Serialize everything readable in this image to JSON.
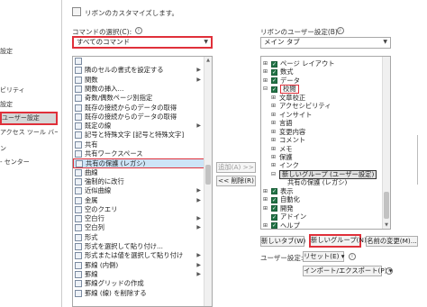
{
  "sidebar": {
    "items": [
      {
        "label": "設定"
      },
      {
        "label": "ビリティ"
      },
      {
        "label": "設定"
      },
      {
        "label": "ユーザー設定",
        "active": true
      },
      {
        "label": "アクセス ツール バー"
      },
      {
        "label": "ン"
      },
      {
        "label": "- センター"
      }
    ]
  },
  "header": {
    "title": "リボンのカスタマイズします。"
  },
  "left": {
    "label": "コマンドの選択(C):",
    "dropdown_value": "すべてのコマンド",
    "commands": [
      {
        "label": "",
        "arrow": false
      },
      {
        "label": "隣のセルの書式を設定する",
        "arrow": true
      },
      {
        "label": "関数",
        "arrow": true
      },
      {
        "label": "関数の挿入...",
        "arrow": false
      },
      {
        "label": "奇数/偶数ページ別指定",
        "arrow": false
      },
      {
        "label": "既存の接続からのデータの取得",
        "arrow": false
      },
      {
        "label": "既存の接続からのデータの取得",
        "arrow": false
      },
      {
        "label": "既定の線",
        "arrow": true
      },
      {
        "label": "記号と特殊文字 [記号と特殊文字]",
        "arrow": false
      },
      {
        "label": "共有",
        "arrow": false
      },
      {
        "label": "共有ワークスペース",
        "arrow": false
      },
      {
        "label": "共有の保護 (レガシ)",
        "arrow": false,
        "selected": true
      },
      {
        "label": "曲線",
        "arrow": false
      },
      {
        "label": "強制的に改行",
        "arrow": false
      },
      {
        "label": "近似曲線",
        "arrow": true
      },
      {
        "label": "金属",
        "arrow": true
      },
      {
        "label": "空のクエリ",
        "arrow": false
      },
      {
        "label": "空白行",
        "arrow": true
      },
      {
        "label": "空白列",
        "arrow": true
      },
      {
        "label": "形式",
        "arrow": false
      },
      {
        "label": "形式を選択して貼り付け...",
        "arrow": false
      },
      {
        "label": "形式または値を選択して貼り付け",
        "arrow": true
      },
      {
        "label": "罫線 (内側)",
        "arrow": true
      },
      {
        "label": "罫線",
        "arrow": true
      },
      {
        "label": "罫線グリッドの作成",
        "arrow": false
      },
      {
        "label": "罫線 (線) を削除する",
        "arrow": false
      }
    ]
  },
  "middle": {
    "add_label": "追加(A) >>",
    "remove_label": "<< 削除(R)"
  },
  "right": {
    "label": "リボンのユーザー設定(B):",
    "dropdown_value": "メイン タブ",
    "tree": [
      {
        "label": "ページ レイアウト",
        "level": 0,
        "exp": "⊞",
        "checked": true
      },
      {
        "label": "数式",
        "level": 0,
        "exp": "⊞",
        "checked": true
      },
      {
        "label": "データ",
        "level": 0,
        "exp": "⊞",
        "checked": true
      },
      {
        "label": "校閲",
        "level": 0,
        "exp": "⊟",
        "checked": true,
        "boxed": true
      },
      {
        "label": "文章校正",
        "level": 1,
        "exp": "⊞",
        "checked": false
      },
      {
        "label": "アクセシビリティ",
        "level": 1,
        "exp": "⊞",
        "checked": false
      },
      {
        "label": "インサイト",
        "level": 1,
        "exp": "⊞",
        "checked": false
      },
      {
        "label": "言語",
        "level": 1,
        "exp": "⊞",
        "checked": false
      },
      {
        "label": "変更内容",
        "level": 1,
        "exp": "⊞",
        "checked": false
      },
      {
        "label": "コメント",
        "level": 1,
        "exp": "⊞",
        "checked": false
      },
      {
        "label": "メモ",
        "level": 1,
        "exp": "⊞",
        "checked": false
      },
      {
        "label": "保護",
        "level": 1,
        "exp": "⊞",
        "checked": false
      },
      {
        "label": "インク",
        "level": 1,
        "exp": "⊞",
        "checked": false
      },
      {
        "label": "新しいグループ (ユーザー設定)",
        "level": 1,
        "exp": "⊟",
        "checked": false,
        "highlight": true
      },
      {
        "label": "共有の保護 (レガシ)",
        "level": 2,
        "exp": "",
        "checked": false
      },
      {
        "label": "表示",
        "level": 0,
        "exp": "⊞",
        "checked": true
      },
      {
        "label": "自動化",
        "level": 0,
        "exp": "⊞",
        "checked": true
      },
      {
        "label": "開発",
        "level": 0,
        "exp": "⊞",
        "checked": true
      },
      {
        "label": "アドイン",
        "level": 0,
        "exp": "",
        "checked": true
      },
      {
        "label": "ヘルプ",
        "level": 0,
        "exp": "⊞",
        "checked": true
      }
    ],
    "new_tab_label": "新しいタブ(W)",
    "new_group_label": "新しいグループ(N)",
    "rename_label": "名前の変更(M)...",
    "user_settings_label": "ユーザー設定:",
    "reset_label": "リセット(E) ▾",
    "import_export_label": "インポート/エクスポート(P) ▾"
  },
  "colors": {
    "accent_red": "#e0303a",
    "check_green": "#217346",
    "selection_blue": "#cde4f7"
  },
  "icons": {
    "chevron": "chevron-down-icon",
    "info": "info-icon"
  }
}
